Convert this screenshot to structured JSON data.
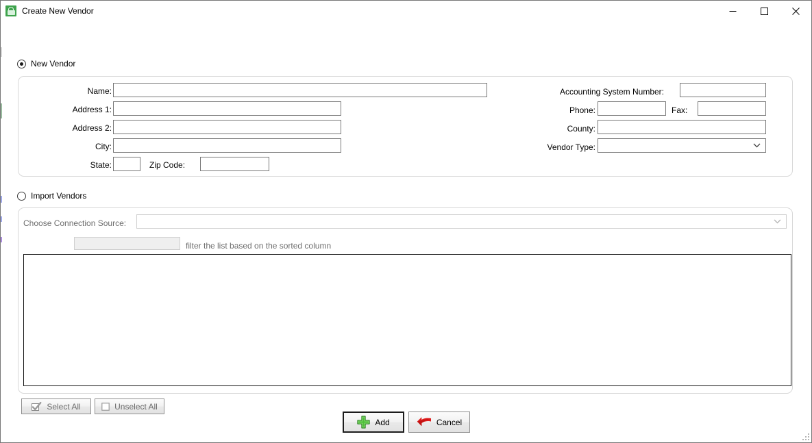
{
  "window": {
    "title": "Create New Vendor",
    "app_icon": "vendor-app-icon",
    "minimize_label": "Minimize",
    "maximize_label": "Maximize",
    "close_label": "Close"
  },
  "new_vendor": {
    "radio_label": "New Vendor",
    "selected": true,
    "fields": {
      "name_label": "Name:",
      "name_value": "",
      "address1_label": "Address 1:",
      "address1_value": "",
      "address2_label": "Address 2:",
      "address2_value": "",
      "city_label": "City:",
      "city_value": "",
      "state_label": "State:",
      "state_value": "",
      "zip_label": "Zip Code:",
      "zip_value": "",
      "accounting_label": "Accounting System Number:",
      "accounting_value": "",
      "phone_label": "Phone:",
      "phone_value": "",
      "fax_label": "Fax:",
      "fax_value": "",
      "county_label": "County:",
      "county_value": "",
      "vendor_type_label": "Vendor Type:",
      "vendor_type_value": ""
    }
  },
  "import_vendors": {
    "radio_label": "Import Vendors",
    "selected": false,
    "connection_source_label": "Choose Connection Source:",
    "connection_source_value": "",
    "filter_value": "",
    "filter_hint": "filter the list based on the sorted column",
    "list_items": [],
    "select_all_label": "Select All",
    "select_all_icon": "check-mark-icon",
    "unselect_all_label": "Unselect All",
    "unselect_all_icon": "empty-box-icon"
  },
  "actions": {
    "add_label": "Add",
    "add_icon": "green-plus-icon",
    "cancel_label": "Cancel",
    "cancel_icon": "red-undo-arrow-icon"
  },
  "colors": {
    "app_icon_green": "#3fa34d",
    "add_plus_green": "#33a02c",
    "cancel_red": "#e01b1b",
    "border_gray": "#767676",
    "group_border": "#d8d8d8",
    "disabled_text": "#6d6d6d"
  }
}
